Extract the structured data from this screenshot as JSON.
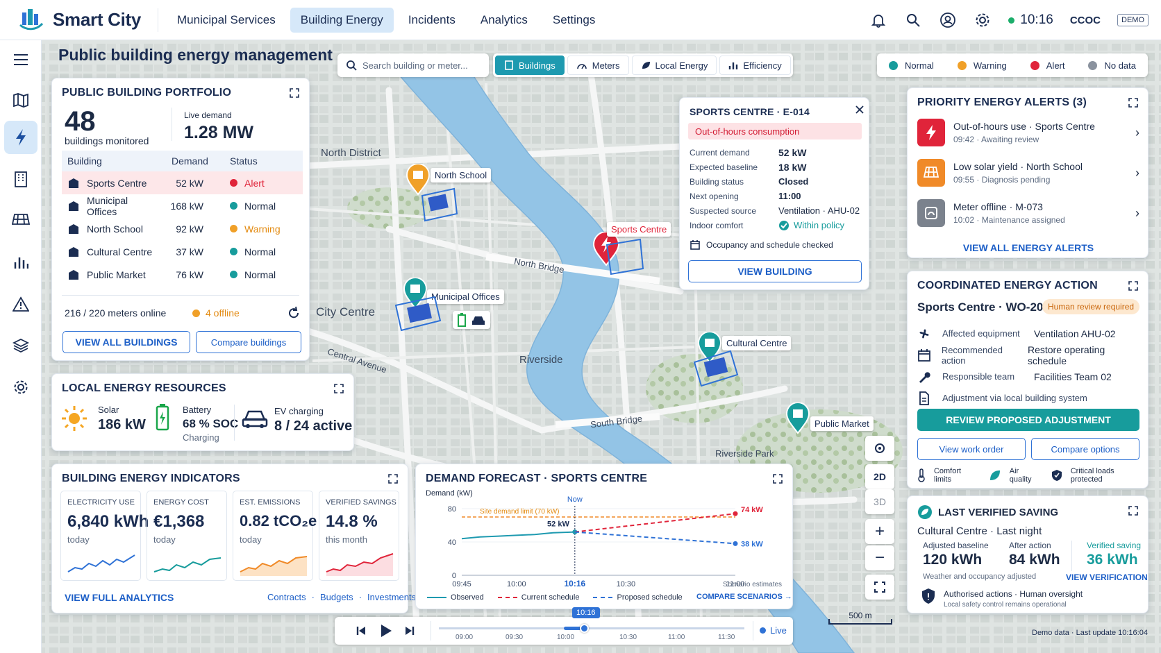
{
  "app": {
    "name": "Smart City",
    "time": "10:16",
    "user": "CCOC",
    "mode": "DEMO"
  },
  "nav": [
    "Municipal Services",
    "Building Energy",
    "Incidents",
    "Analytics",
    "Settings"
  ],
  "page_title": "Public building energy management",
  "search": {
    "placeholder": "Search building or meter..."
  },
  "layers": [
    "Buildings",
    "Meters",
    "Local Energy",
    "Efficiency"
  ],
  "legend": [
    {
      "label": "Normal",
      "color": "#179c9c"
    },
    {
      "label": "Warning",
      "color": "#f0a028"
    },
    {
      "label": "Alert",
      "color": "#e0243a"
    },
    {
      "label": "No data",
      "color": "#8a929e"
    }
  ],
  "portfolio": {
    "title": "PUBLIC BUILDING PORTFOLIO",
    "count": "48",
    "count_label": "buildings monitored",
    "demand_label": "Live demand",
    "demand_value": "1.28 MW",
    "headers": [
      "Building",
      "Demand",
      "Status"
    ],
    "rows": [
      {
        "name": "Sports Centre",
        "demand": "52 kW",
        "status": "Alert",
        "color": "#e0243a"
      },
      {
        "name": "Municipal Offices",
        "demand": "168 kW",
        "status": "Normal",
        "color": "#179c9c"
      },
      {
        "name": "North School",
        "demand": "92 kW",
        "status": "Warning",
        "color": "#f0a028"
      },
      {
        "name": "Cultural Centre",
        "demand": "37 kW",
        "status": "Normal",
        "color": "#179c9c"
      },
      {
        "name": "Public Market",
        "demand": "76 kW",
        "status": "Normal",
        "color": "#179c9c"
      }
    ],
    "meters": "216 / 220 meters online",
    "offline": "4 offline",
    "view_all": "VIEW ALL BUILDINGS",
    "compare": "Compare buildings"
  },
  "local": {
    "title": "LOCAL ENERGY RESOURCES",
    "solar_label": "Solar",
    "solar_value": "186 kW",
    "battery_label": "Battery",
    "battery_value": "68 % SOC",
    "battery_sub": "Charging",
    "ev_label": "EV charging",
    "ev_value": "8 / 24 active"
  },
  "indicators": {
    "title": "BUILDING ENERGY INDICATORS",
    "items": [
      {
        "label": "ELECTRICITY USE",
        "value": "6,840 kWh",
        "sub": "today",
        "color": "#2f72d6"
      },
      {
        "label": "ENERGY COST",
        "value": "€1,368",
        "sub": "today",
        "color": "#179c9c"
      },
      {
        "label": "EST. EMISSIONS",
        "value": "0.82 tCO₂e",
        "sub": "today",
        "color": "#f08a28"
      },
      {
        "label": "VERIFIED SAVINGS",
        "value": "14.8 %",
        "sub": "this month",
        "color": "#e0243a"
      }
    ],
    "view_full": "VIEW FULL ANALYTICS",
    "links": [
      "Contracts",
      "Budgets",
      "Investments"
    ]
  },
  "forecast": {
    "title": "DEMAND FORECAST · SPORTS CENTRE",
    "ylabel": "Demand (kW)",
    "now_label": "Now",
    "limit_label": "Site demand limit (70 kW)",
    "point_label": "52 kW",
    "high_label": "74 kW",
    "low_label": "38 kW",
    "note": "Scenario estimates",
    "legend": [
      "Observed",
      "Current schedule",
      "Proposed schedule"
    ],
    "compare": "COMPARE SCENARIOS →"
  },
  "chart_data": {
    "type": "line",
    "title": "DEMAND FORECAST · SPORTS CENTRE",
    "ylabel": "Demand (kW)",
    "xlabel": "",
    "x_ticks": [
      "09:45",
      "10:00",
      "10:16",
      "10:30",
      "11:00"
    ],
    "ylim": [
      0,
      80
    ],
    "y_ticks": [
      0,
      40,
      80
    ],
    "limit": 70,
    "series": [
      {
        "name": "Observed",
        "x": [
          "09:45",
          "09:50",
          "09:55",
          "10:00",
          "10:05",
          "10:10",
          "10:16"
        ],
        "values": [
          44,
          46,
          47,
          48,
          49,
          51,
          52
        ],
        "color": "#1e9ab0",
        "style": "solid"
      },
      {
        "name": "Current schedule",
        "x": [
          "10:16",
          "11:00"
        ],
        "values": [
          52,
          74
        ],
        "color": "#e0243a",
        "style": "dashed"
      },
      {
        "name": "Proposed schedule",
        "x": [
          "10:16",
          "11:00"
        ],
        "values": [
          52,
          38
        ],
        "color": "#2f72d6",
        "style": "dashed"
      }
    ]
  },
  "map": {
    "labels": {
      "north_district": "North District",
      "city_centre": "City Centre",
      "riverside": "Riverside",
      "riverside_park": "Riverside Park",
      "north_bridge": "North Bridge",
      "south_bridge": "South Bridge",
      "central_avenue": "Central Avenue"
    },
    "markers": [
      "North School",
      "Municipal Offices",
      "Sports Centre",
      "Cultural Centre",
      "Public Market"
    ],
    "scale": "500 m",
    "view_2d": "2D",
    "view_3d": "3D"
  },
  "popup": {
    "title": "SPORTS CENTRE · E-014",
    "banner": "Out-of-hours consumption",
    "rows": [
      {
        "k": "Current demand",
        "v": "52 kW"
      },
      {
        "k": "Expected baseline",
        "v": "18 kW"
      },
      {
        "k": "Building status",
        "v": "Closed"
      },
      {
        "k": "Next opening",
        "v": "11:00"
      },
      {
        "k": "Suspected source",
        "v": "Ventilation · AHU-02"
      },
      {
        "k": "Indoor comfort",
        "v": "Within policy"
      }
    ],
    "check": "Occupancy and schedule checked",
    "button": "VIEW BUILDING"
  },
  "alerts": {
    "title": "PRIORITY ENERGY ALERTS (3)",
    "items": [
      {
        "title": "Out-of-hours use · Sports Centre",
        "sub": "09:42 · Awaiting review",
        "color": "#e0243a"
      },
      {
        "title": "Low solar yield · North School",
        "sub": "09:55 · Diagnosis pending",
        "color": "#f08a28"
      },
      {
        "title": "Meter offline · M-073",
        "sub": "10:02 · Maintenance assigned",
        "color": "#7b828d"
      }
    ],
    "view_all": "VIEW ALL ENERGY ALERTS"
  },
  "action": {
    "title": "COORDINATED ENERGY ACTION",
    "target": "Sports Centre · WO-207",
    "badge": "Human review required",
    "rows": [
      {
        "k": "Affected equipment",
        "v": "Ventilation AHU-02"
      },
      {
        "k": "Recommended action",
        "v": "Restore operating schedule"
      },
      {
        "k": "Responsible team",
        "v": "Facilities Team 02"
      }
    ],
    "note": "Adjustment via local building system",
    "primary": "REVIEW PROPOSED ADJUSTMENT",
    "work_order": "View work order",
    "compare": "Compare options",
    "footer": [
      "Comfort limits",
      "Air quality",
      "Critical loads protected"
    ]
  },
  "saving": {
    "title": "LAST VERIFIED SAVING",
    "subtitle": "Cultural Centre · Last night",
    "baseline_label": "Adjusted baseline",
    "baseline_value": "120 kWh",
    "after_label": "After action",
    "after_value": "84 kWh",
    "saved_label": "Verified saving",
    "saved_value": "36 kWh",
    "note": "Weather and occupancy adjusted",
    "verify": "VIEW VERIFICATION",
    "auth": "Authorised actions · Human oversight",
    "auth_sub": "Local safety control remains operational"
  },
  "timeline": {
    "ticks": [
      "09:00",
      "09:30",
      "10:00",
      "10:30",
      "11:00",
      "11:30"
    ],
    "current": "10:16",
    "live": "Live"
  },
  "footer": "Demo data · Last update 10:16:04"
}
